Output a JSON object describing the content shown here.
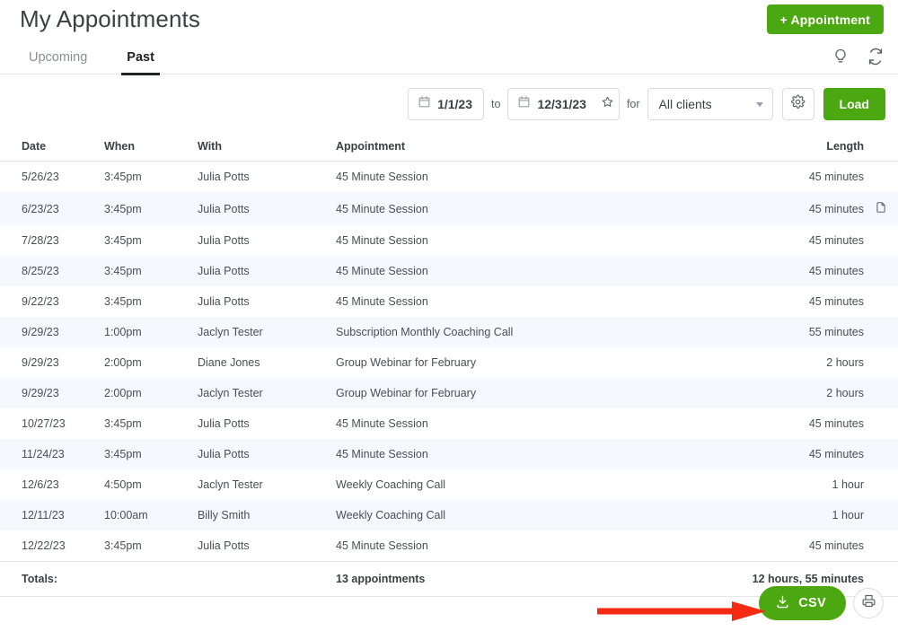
{
  "header": {
    "title": "My Appointments",
    "new_appointment_label": "+ Appointment",
    "accent_green": "#4ca810",
    "icons": {
      "tips": "lightbulb-icon",
      "sync": "sync-refresh-icon"
    }
  },
  "tabs": [
    {
      "label": "Upcoming",
      "active": false
    },
    {
      "label": "Past",
      "active": true
    }
  ],
  "filters": {
    "date_from": "1/1/23",
    "to_label": "to",
    "date_to": "12/31/23",
    "favorite_icon": "star-icon",
    "for_label": "for",
    "client_select": "All clients",
    "settings_icon": "gear-icon",
    "load_label": "Load"
  },
  "table": {
    "columns": [
      "Date",
      "When",
      "With",
      "Appointment",
      "Length"
    ],
    "rows": [
      {
        "date": "5/26/23",
        "when": "3:45pm",
        "with": "Julia Potts",
        "appointment": "45 Minute Session",
        "length": "45 minutes",
        "doc": ""
      },
      {
        "date": "6/23/23",
        "when": "3:45pm",
        "with": "Julia Potts",
        "appointment": "45 Minute Session",
        "length": "45 minutes",
        "doc": "document-icon"
      },
      {
        "date": "7/28/23",
        "when": "3:45pm",
        "with": "Julia Potts",
        "appointment": "45 Minute Session",
        "length": "45 minutes",
        "doc": ""
      },
      {
        "date": "8/25/23",
        "when": "3:45pm",
        "with": "Julia Potts",
        "appointment": "45 Minute Session",
        "length": "45 minutes",
        "doc": ""
      },
      {
        "date": "9/22/23",
        "when": "3:45pm",
        "with": "Julia Potts",
        "appointment": "45 Minute Session",
        "length": "45 minutes",
        "doc": ""
      },
      {
        "date": "9/29/23",
        "when": "1:00pm",
        "with": "Jaclyn Tester",
        "appointment": "Subscription Monthly Coaching Call",
        "length": "55 minutes",
        "doc": ""
      },
      {
        "date": "9/29/23",
        "when": "2:00pm",
        "with": "Diane Jones",
        "appointment": "Group Webinar for February",
        "length": "2 hours",
        "doc": ""
      },
      {
        "date": "9/29/23",
        "when": "2:00pm",
        "with": "Jaclyn Tester",
        "appointment": "Group Webinar for February",
        "length": "2 hours",
        "doc": ""
      },
      {
        "date": "10/27/23",
        "when": "3:45pm",
        "with": "Julia Potts",
        "appointment": "45 Minute Session",
        "length": "45 minutes",
        "doc": ""
      },
      {
        "date": "11/24/23",
        "when": "3:45pm",
        "with": "Julia Potts",
        "appointment": "45 Minute Session",
        "length": "45 minutes",
        "doc": ""
      },
      {
        "date": "12/6/23",
        "when": "4:50pm",
        "with": "Jaclyn Tester",
        "appointment": "Weekly Coaching Call",
        "length": "1 hour",
        "doc": ""
      },
      {
        "date": "12/11/23",
        "when": "10:00am",
        "with": "Billy Smith",
        "appointment": "Weekly Coaching Call",
        "length": "1 hour",
        "doc": ""
      },
      {
        "date": "12/22/23",
        "when": "3:45pm",
        "with": "Julia Potts",
        "appointment": "45 Minute Session",
        "length": "45 minutes",
        "doc": ""
      }
    ],
    "totals": {
      "label": "Totals:",
      "count": "13 appointments",
      "duration": "12 hours, 55 minutes"
    }
  },
  "footer": {
    "csv_label": "CSV",
    "download_icon": "download-icon",
    "print_icon": "printer-icon"
  },
  "annotation": {
    "arrow_color": "#f42a12",
    "points_to": "CSV"
  }
}
